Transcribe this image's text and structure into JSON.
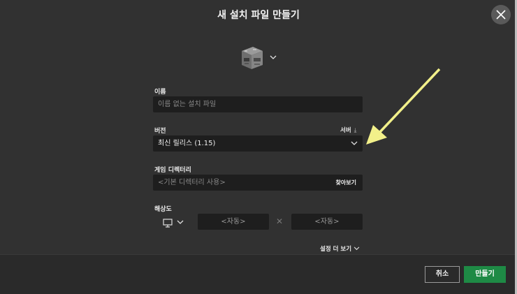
{
  "dialog": {
    "title": "새 설치 파일 만들기"
  },
  "icon_picker": {
    "icon": "furnace-block-icon"
  },
  "name": {
    "label": "이름",
    "placeholder": "이름 없는 설치 파일"
  },
  "version": {
    "label": "버전",
    "server_link": "서버",
    "selected": "최신 릴리스 (1.15)"
  },
  "game_directory": {
    "label": "게임 디렉터리",
    "placeholder": "<기본 디렉터리 사용>",
    "browse": "찾아보기"
  },
  "resolution": {
    "label": "해상도",
    "width_placeholder": "<자동>",
    "height_placeholder": "<자동>",
    "separator": "✕"
  },
  "more_settings": "설정 더 보기",
  "footer": {
    "cancel": "취소",
    "create": "만들기"
  },
  "annotation": {
    "color": "#f2f08a"
  }
}
